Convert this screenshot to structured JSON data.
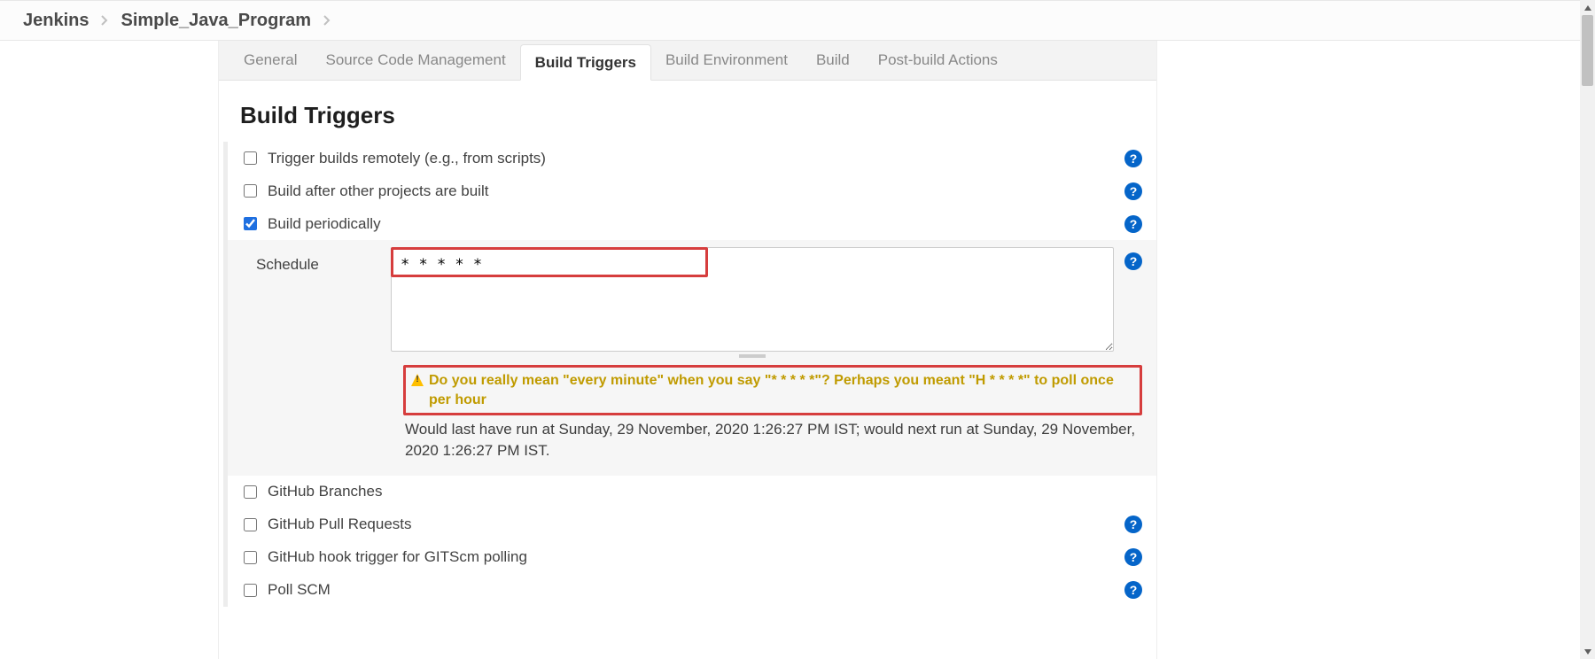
{
  "breadcrumb": {
    "root": "Jenkins",
    "project": "Simple_Java_Program"
  },
  "tabs": {
    "general": "General",
    "scm": "Source Code Management",
    "build_triggers": "Build Triggers",
    "build_env": "Build Environment",
    "build": "Build",
    "post_build": "Post-build Actions"
  },
  "section": {
    "title": "Build Triggers"
  },
  "triggers": {
    "remote": {
      "label": "Trigger builds remotely (e.g., from scripts)",
      "checked": false
    },
    "after": {
      "label": "Build after other projects are built",
      "checked": false
    },
    "periodic": {
      "label": "Build periodically",
      "checked": true
    },
    "gh_branches": {
      "label": "GitHub Branches",
      "checked": false
    },
    "gh_prs": {
      "label": "GitHub Pull Requests",
      "checked": false
    },
    "gh_hook": {
      "label": "GitHub hook trigger for GITScm polling",
      "checked": false
    },
    "poll_scm": {
      "label": "Poll SCM",
      "checked": false
    }
  },
  "schedule": {
    "label": "Schedule",
    "value": "* * * * *",
    "warning": "Do you really mean \"every minute\" when you say \"* * * * *\"? Perhaps you meant \"H * * * *\" to poll once per hour",
    "info": "Would last have run at Sunday, 29 November, 2020 1:26:27 PM IST; would next run at Sunday, 29 November, 2020 1:26:27 PM IST."
  },
  "help_glyph": "?"
}
